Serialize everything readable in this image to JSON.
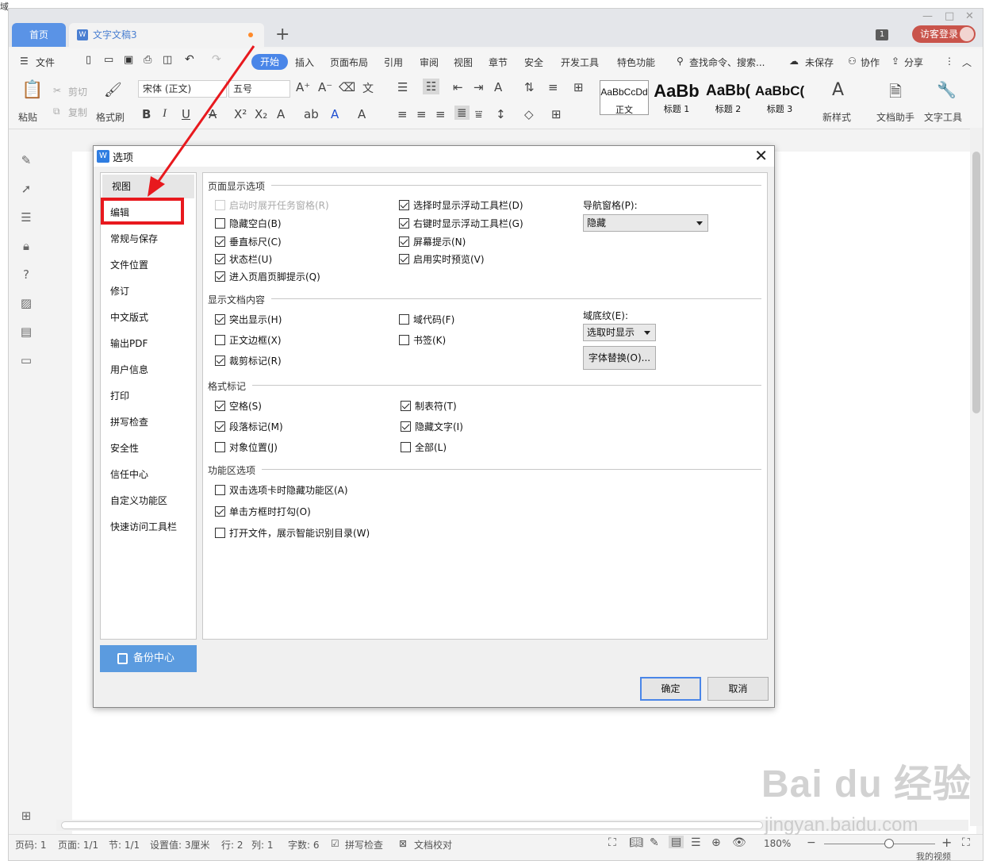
{
  "corner_text": "域",
  "tabs": {
    "home": "首页",
    "doc": "文字文稿3",
    "badge": "1",
    "visitor": "访客登录"
  },
  "menu": {
    "file": "文件",
    "active": "开始",
    "items": [
      "插入",
      "页面布局",
      "引用",
      "审阅",
      "视图",
      "章节",
      "安全",
      "开发工具",
      "特色功能"
    ],
    "search": "查找命令、搜索...",
    "unsaved": "未保存",
    "collab": "协作",
    "share": "分享"
  },
  "ribbon": {
    "paste": "粘贴",
    "cut": "剪切",
    "copy": "复制",
    "format_brush": "格式刷",
    "font": "宋体 (正文)",
    "size": "五号",
    "styles": [
      {
        "sample": "AaBbCcDd",
        "caption": "正文"
      },
      {
        "sample": "AaBb",
        "caption": "标题 1"
      },
      {
        "sample": "AaBb(",
        "caption": "标题 2"
      },
      {
        "sample": "AaBbC(",
        "caption": "标题 3"
      }
    ],
    "new_style": "新样式",
    "doc_assist": "文档助手",
    "text_tools": "文字工具"
  },
  "dialog": {
    "title": "选项",
    "categories": [
      "视图",
      "编辑",
      "常规与保存",
      "文件位置",
      "修订",
      "中文版式",
      "输出PDF",
      "用户信息",
      "打印",
      "拼写检查",
      "安全性",
      "信任中心",
      "自定义功能区",
      "快速访问工具栏"
    ],
    "backup": "备份中心",
    "sections": {
      "page_display": "页面显示选项",
      "doc_content": "显示文档内容",
      "format_marks": "格式标记",
      "ribbon_opts": "功能区选项"
    },
    "page_display_left": [
      {
        "label": "启动时展开任务窗格(R)",
        "checked": false,
        "disabled": true
      },
      {
        "label": "隐藏空白(B)",
        "checked": false
      },
      {
        "label": "垂直标尺(C)",
        "checked": true
      },
      {
        "label": "状态栏(U)",
        "checked": true
      },
      {
        "label": "进入页眉页脚提示(Q)",
        "checked": true
      }
    ],
    "page_display_mid": [
      {
        "label": "选择时显示浮动工具栏(D)",
        "checked": true
      },
      {
        "label": "右键时显示浮动工具栏(G)",
        "checked": true
      },
      {
        "label": "屏幕提示(N)",
        "checked": true
      },
      {
        "label": "启用实时预览(V)",
        "checked": true
      }
    ],
    "nav_label": "导航窗格(P):",
    "nav_value": "隐藏",
    "doc_content_left": [
      {
        "label": "突出显示(H)",
        "checked": true
      },
      {
        "label": "正文边框(X)",
        "checked": false
      },
      {
        "label": "裁剪标记(R)",
        "checked": true
      }
    ],
    "doc_content_mid": [
      {
        "label": "域代码(F)",
        "checked": false
      },
      {
        "label": "书签(K)",
        "checked": false
      }
    ],
    "field_shade_label": "域底纹(E):",
    "field_shade_value": "选取时显示",
    "font_sub_button": "字体替换(O)...",
    "format_left": [
      {
        "label": "空格(S)",
        "checked": true
      },
      {
        "label": "段落标记(M)",
        "checked": true
      },
      {
        "label": "对象位置(J)",
        "checked": false
      }
    ],
    "format_mid": [
      {
        "label": "制表符(T)",
        "checked": true
      },
      {
        "label": "隐藏文字(I)",
        "checked": true
      },
      {
        "label": "全部(L)",
        "checked": false
      }
    ],
    "ribbon_items": [
      {
        "label": "双击选项卡时隐藏功能区(A)",
        "checked": false
      },
      {
        "label": "单击方框时打勾(O)",
        "checked": true
      },
      {
        "label": "打开文件，展示智能识别目录(W)",
        "checked": false
      }
    ],
    "ok": "确定",
    "cancel": "取消"
  },
  "status": {
    "page_code": "页码: 1",
    "pages": "页面: 1/1",
    "section": "节: 1/1",
    "setting": "设置值: 3厘米",
    "row": "行: 2",
    "col": "列: 1",
    "words": "字数: 6",
    "spell": "拼写检查",
    "proof": "文档校对",
    "zoom": "180%",
    "my_video": "我的视频"
  },
  "watermark": {
    "line1": "Bai du 经验",
    "line2": "jingyan.baidu.com"
  },
  "colors": {
    "accent": "#4a86e8",
    "highlight": "#e8191e",
    "visitor": "#c9544b"
  }
}
